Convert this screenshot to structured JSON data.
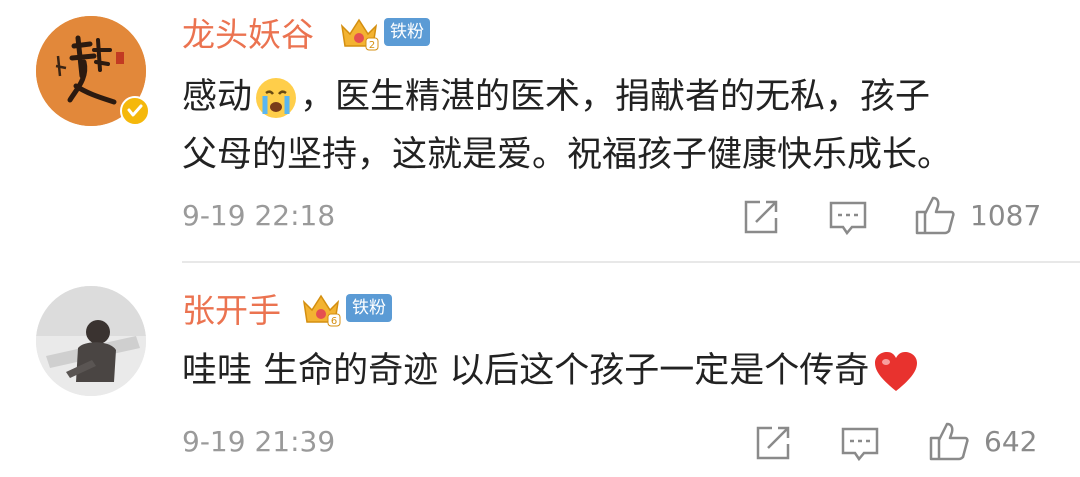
{
  "comments": [
    {
      "username": "龙头妖谷",
      "badge": "铁粉",
      "crown_level": "2",
      "text_line1_a": "感动",
      "emoji1": "crying-emoji",
      "text_line1_b": "，医生精湛的医术，捐献者的无私，孩子",
      "text_line2": "父母的坚持，这就是爱。祝福孩子健康快乐成长。",
      "timestamp": "9-19 22:18",
      "like_count": "1087"
    },
    {
      "username": "张开手",
      "badge": "铁粉",
      "crown_level": "6",
      "text_line1": "哇哇 生命的奇迹 以后这个孩子一定是个传奇",
      "emoji1": "red-heart-emoji",
      "timestamp": "9-19 21:39",
      "like_count": "642"
    }
  ],
  "colors": {
    "username": "#eb7350",
    "badge": "#5b9bd5",
    "crown": "#f3b332",
    "meta": "#9a9a9a",
    "verified": "#f5b80b"
  },
  "icons": [
    "share-icon",
    "comment-icon",
    "like-icon",
    "crown-icon",
    "verified-icon"
  ]
}
